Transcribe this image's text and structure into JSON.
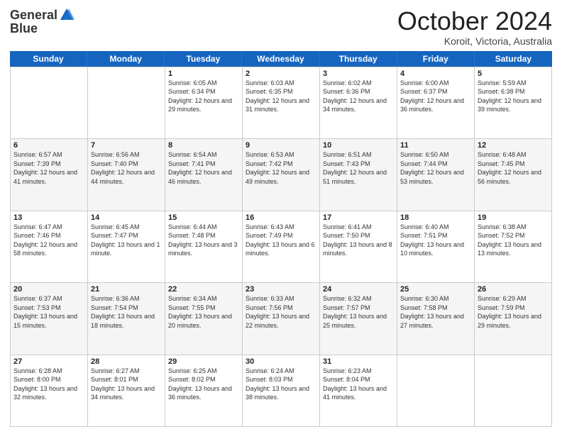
{
  "header": {
    "logo_general": "General",
    "logo_blue": "Blue",
    "month_title": "October 2024",
    "location": "Koroit, Victoria, Australia"
  },
  "days_of_week": [
    "Sunday",
    "Monday",
    "Tuesday",
    "Wednesday",
    "Thursday",
    "Friday",
    "Saturday"
  ],
  "weeks": [
    [
      {
        "day": "",
        "sunrise": "",
        "sunset": "",
        "daylight": "",
        "empty": true
      },
      {
        "day": "",
        "sunrise": "",
        "sunset": "",
        "daylight": "",
        "empty": true
      },
      {
        "day": "1",
        "sunrise": "Sunrise: 6:05 AM",
        "sunset": "Sunset: 6:34 PM",
        "daylight": "Daylight: 12 hours and 29 minutes.",
        "empty": false
      },
      {
        "day": "2",
        "sunrise": "Sunrise: 6:03 AM",
        "sunset": "Sunset: 6:35 PM",
        "daylight": "Daylight: 12 hours and 31 minutes.",
        "empty": false
      },
      {
        "day": "3",
        "sunrise": "Sunrise: 6:02 AM",
        "sunset": "Sunset: 6:36 PM",
        "daylight": "Daylight: 12 hours and 34 minutes.",
        "empty": false
      },
      {
        "day": "4",
        "sunrise": "Sunrise: 6:00 AM",
        "sunset": "Sunset: 6:37 PM",
        "daylight": "Daylight: 12 hours and 36 minutes.",
        "empty": false
      },
      {
        "day": "5",
        "sunrise": "Sunrise: 5:59 AM",
        "sunset": "Sunset: 6:38 PM",
        "daylight": "Daylight: 12 hours and 39 minutes.",
        "empty": false
      }
    ],
    [
      {
        "day": "6",
        "sunrise": "Sunrise: 6:57 AM",
        "sunset": "Sunset: 7:39 PM",
        "daylight": "Daylight: 12 hours and 41 minutes.",
        "empty": false
      },
      {
        "day": "7",
        "sunrise": "Sunrise: 6:56 AM",
        "sunset": "Sunset: 7:40 PM",
        "daylight": "Daylight: 12 hours and 44 minutes.",
        "empty": false
      },
      {
        "day": "8",
        "sunrise": "Sunrise: 6:54 AM",
        "sunset": "Sunset: 7:41 PM",
        "daylight": "Daylight: 12 hours and 46 minutes.",
        "empty": false
      },
      {
        "day": "9",
        "sunrise": "Sunrise: 6:53 AM",
        "sunset": "Sunset: 7:42 PM",
        "daylight": "Daylight: 12 hours and 49 minutes.",
        "empty": false
      },
      {
        "day": "10",
        "sunrise": "Sunrise: 6:51 AM",
        "sunset": "Sunset: 7:43 PM",
        "daylight": "Daylight: 12 hours and 51 minutes.",
        "empty": false
      },
      {
        "day": "11",
        "sunrise": "Sunrise: 6:50 AM",
        "sunset": "Sunset: 7:44 PM",
        "daylight": "Daylight: 12 hours and 53 minutes.",
        "empty": false
      },
      {
        "day": "12",
        "sunrise": "Sunrise: 6:48 AM",
        "sunset": "Sunset: 7:45 PM",
        "daylight": "Daylight: 12 hours and 56 minutes.",
        "empty": false
      }
    ],
    [
      {
        "day": "13",
        "sunrise": "Sunrise: 6:47 AM",
        "sunset": "Sunset: 7:46 PM",
        "daylight": "Daylight: 12 hours and 58 minutes.",
        "empty": false
      },
      {
        "day": "14",
        "sunrise": "Sunrise: 6:45 AM",
        "sunset": "Sunset: 7:47 PM",
        "daylight": "Daylight: 13 hours and 1 minute.",
        "empty": false
      },
      {
        "day": "15",
        "sunrise": "Sunrise: 6:44 AM",
        "sunset": "Sunset: 7:48 PM",
        "daylight": "Daylight: 13 hours and 3 minutes.",
        "empty": false
      },
      {
        "day": "16",
        "sunrise": "Sunrise: 6:43 AM",
        "sunset": "Sunset: 7:49 PM",
        "daylight": "Daylight: 13 hours and 6 minutes.",
        "empty": false
      },
      {
        "day": "17",
        "sunrise": "Sunrise: 6:41 AM",
        "sunset": "Sunset: 7:50 PM",
        "daylight": "Daylight: 13 hours and 8 minutes.",
        "empty": false
      },
      {
        "day": "18",
        "sunrise": "Sunrise: 6:40 AM",
        "sunset": "Sunset: 7:51 PM",
        "daylight": "Daylight: 13 hours and 10 minutes.",
        "empty": false
      },
      {
        "day": "19",
        "sunrise": "Sunrise: 6:38 AM",
        "sunset": "Sunset: 7:52 PM",
        "daylight": "Daylight: 13 hours and 13 minutes.",
        "empty": false
      }
    ],
    [
      {
        "day": "20",
        "sunrise": "Sunrise: 6:37 AM",
        "sunset": "Sunset: 7:53 PM",
        "daylight": "Daylight: 13 hours and 15 minutes.",
        "empty": false
      },
      {
        "day": "21",
        "sunrise": "Sunrise: 6:36 AM",
        "sunset": "Sunset: 7:54 PM",
        "daylight": "Daylight: 13 hours and 18 minutes.",
        "empty": false
      },
      {
        "day": "22",
        "sunrise": "Sunrise: 6:34 AM",
        "sunset": "Sunset: 7:55 PM",
        "daylight": "Daylight: 13 hours and 20 minutes.",
        "empty": false
      },
      {
        "day": "23",
        "sunrise": "Sunrise: 6:33 AM",
        "sunset": "Sunset: 7:56 PM",
        "daylight": "Daylight: 13 hours and 22 minutes.",
        "empty": false
      },
      {
        "day": "24",
        "sunrise": "Sunrise: 6:32 AM",
        "sunset": "Sunset: 7:57 PM",
        "daylight": "Daylight: 13 hours and 25 minutes.",
        "empty": false
      },
      {
        "day": "25",
        "sunrise": "Sunrise: 6:30 AM",
        "sunset": "Sunset: 7:58 PM",
        "daylight": "Daylight: 13 hours and 27 minutes.",
        "empty": false
      },
      {
        "day": "26",
        "sunrise": "Sunrise: 6:29 AM",
        "sunset": "Sunset: 7:59 PM",
        "daylight": "Daylight: 13 hours and 29 minutes.",
        "empty": false
      }
    ],
    [
      {
        "day": "27",
        "sunrise": "Sunrise: 6:28 AM",
        "sunset": "Sunset: 8:00 PM",
        "daylight": "Daylight: 13 hours and 32 minutes.",
        "empty": false
      },
      {
        "day": "28",
        "sunrise": "Sunrise: 6:27 AM",
        "sunset": "Sunset: 8:01 PM",
        "daylight": "Daylight: 13 hours and 34 minutes.",
        "empty": false
      },
      {
        "day": "29",
        "sunrise": "Sunrise: 6:25 AM",
        "sunset": "Sunset: 8:02 PM",
        "daylight": "Daylight: 13 hours and 36 minutes.",
        "empty": false
      },
      {
        "day": "30",
        "sunrise": "Sunrise: 6:24 AM",
        "sunset": "Sunset: 8:03 PM",
        "daylight": "Daylight: 13 hours and 38 minutes.",
        "empty": false
      },
      {
        "day": "31",
        "sunrise": "Sunrise: 6:23 AM",
        "sunset": "Sunset: 8:04 PM",
        "daylight": "Daylight: 13 hours and 41 minutes.",
        "empty": false
      },
      {
        "day": "",
        "sunrise": "",
        "sunset": "",
        "daylight": "",
        "empty": true
      },
      {
        "day": "",
        "sunrise": "",
        "sunset": "",
        "daylight": "",
        "empty": true
      }
    ]
  ]
}
